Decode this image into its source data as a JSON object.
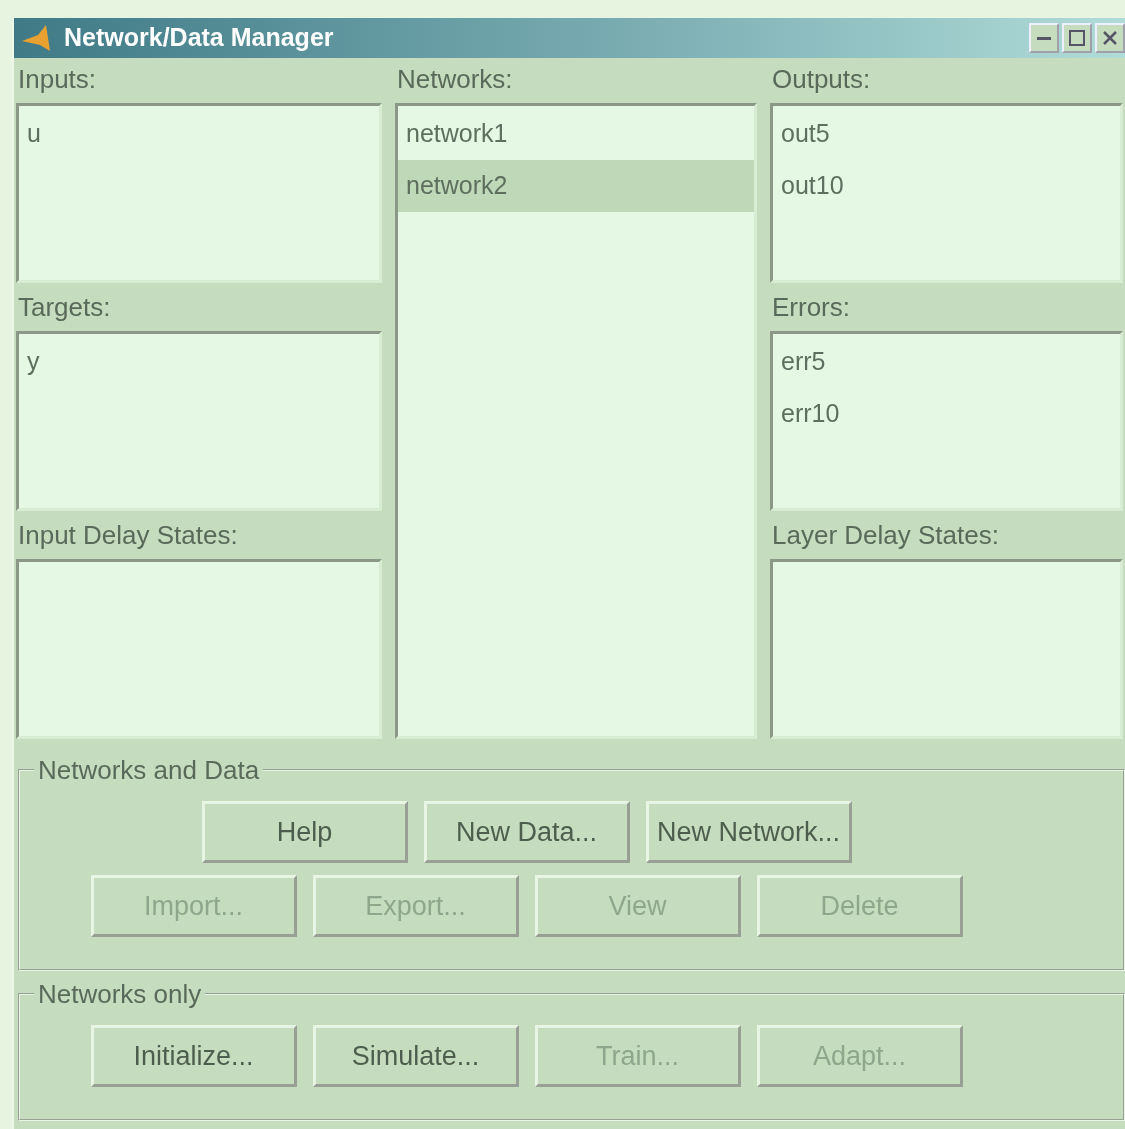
{
  "window": {
    "title": "Network/Data Manager"
  },
  "lists": [
    {
      "label": "Inputs:",
      "items": [
        {
          "text": "u",
          "selected": false
        }
      ]
    },
    {
      "label": "Networks:",
      "items": [
        {
          "text": "network1",
          "selected": false
        },
        {
          "text": "network2",
          "selected": true
        }
      ]
    },
    {
      "label": "Outputs:",
      "items": [
        {
          "text": "out5",
          "selected": false
        },
        {
          "text": "out10",
          "selected": false
        }
      ]
    },
    {
      "label": "Targets:",
      "items": [
        {
          "text": "y",
          "selected": false
        }
      ]
    },
    {
      "label": "Errors:",
      "items": [
        {
          "text": "err5",
          "selected": false
        },
        {
          "text": "err10",
          "selected": false
        }
      ]
    },
    {
      "label": "Input Delay States:"
    },
    {
      "label": "Layer Delay States:"
    }
  ],
  "groups": [
    {
      "title": "Networks and Data",
      "rows": [
        [
          {
            "label": "Help",
            "disabled": false
          },
          {
            "label": "New Data...",
            "disabled": false
          },
          {
            "label": "New Network...",
            "disabled": false
          }
        ],
        [
          {
            "label": "Import...",
            "disabled": true
          },
          {
            "label": "Export...",
            "disabled": true
          },
          {
            "label": "View",
            "disabled": true
          },
          {
            "label": "Delete",
            "disabled": true
          }
        ]
      ]
    },
    {
      "title": "Networks only",
      "rows": [
        [
          {
            "label": "Initialize...",
            "disabled": false
          },
          {
            "label": "Simulate...",
            "disabled": false
          },
          {
            "label": "Train...",
            "disabled": true
          },
          {
            "label": "Adapt...",
            "disabled": true
          }
        ]
      ]
    }
  ]
}
